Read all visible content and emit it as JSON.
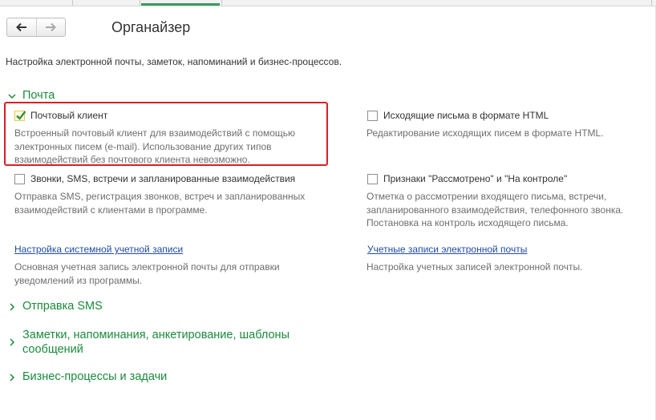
{
  "window": {
    "title": "Органайзер"
  },
  "header": {
    "subtitle": "Настройка электронной почты, заметок, напоминаний и бизнес-процессов."
  },
  "icons": {
    "back": "arrow-left-icon",
    "forward": "arrow-right-icon",
    "expanded": "chevron-down-icon",
    "collapsed": "chevron-right-icon",
    "check": "checkmark-icon"
  },
  "colors": {
    "group_header": "#1a8a3c",
    "link": "#1f4ba5",
    "highlight": "#d91f26",
    "checkbox_checked": "#3c8c3a"
  },
  "mail": {
    "title": "Почта",
    "expanded": true,
    "mail_client": {
      "label": "Почтовый клиент",
      "checked": true,
      "desc1": "Встроенный почтовый клиент для взаимодействий с помощью",
      "desc2": "электронных писем (e-mail). Использование других типов",
      "desc3": "взаимодействий без почтового клиента невозможно."
    },
    "html_outgoing": {
      "label": "Исходящие письма в формате HTML",
      "checked": false,
      "desc1": "Редактирование исходящих писем в формате HTML."
    },
    "calls_sms": {
      "label": "Звонки, SMS, встречи и запланированные взаимодействия",
      "checked": false,
      "desc1": "Отправка SMS, регистрация звонков, встреч и запланированных",
      "desc2": "взаимодействий с клиентами в программе."
    },
    "review_flags": {
      "label": "Признаки \"Рассмотрено\" и \"На контроле\"",
      "checked": false,
      "desc1": "Отметка о рассмотрении входящего письма, встречи,",
      "desc2": "запланированного взаимодействия, телефонного звонка.",
      "desc3": "Постановка на контроль исходящего письма."
    },
    "system_account": {
      "link": "Настройка системной учетной записи",
      "desc1": "Основная учетная запись электронной почты для отправки",
      "desc2": "уведомлений из программы."
    },
    "email_accounts": {
      "link": "Учетные записи электронной почты",
      "desc1": "Настройка учетных записей электронной почты."
    }
  },
  "groups": {
    "sms": {
      "title": "Отправка SMS",
      "expanded": false
    },
    "notes": {
      "line1": "Заметки, напоминания, анкетирование, шаблоны",
      "line2": "сообщений",
      "expanded": false
    },
    "bp": {
      "title": "Бизнес-процессы и задачи",
      "expanded": false
    }
  }
}
